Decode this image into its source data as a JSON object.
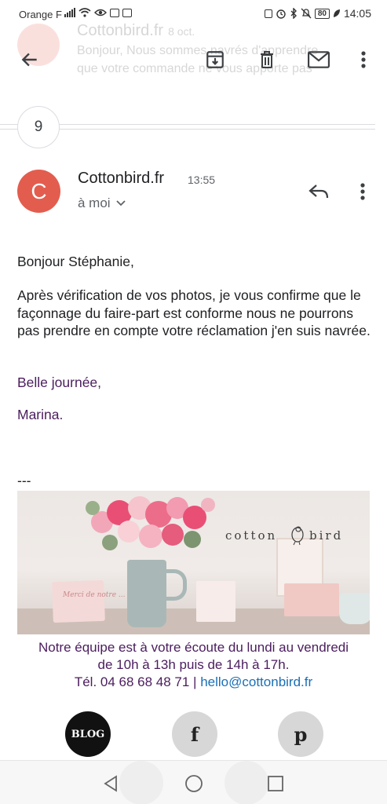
{
  "status_bar": {
    "carrier": "Orange F",
    "battery": "80",
    "time": "14:05"
  },
  "previous_message": {
    "sender": "Cottonbird.fr",
    "date": "8 oct.",
    "line1": "Bonjour, Nous sommes navrés d'apprendre",
    "line2": "que votre commande ne vous apporte pas"
  },
  "toolbar": {
    "back_icon": "arrow-back-icon",
    "archive_icon": "archive-icon",
    "delete_icon": "trash-icon",
    "mark_unread_icon": "mail-icon",
    "more_icon": "more-vert-icon"
  },
  "thread": {
    "collapsed_count": "9"
  },
  "message": {
    "avatar_letter": "C",
    "avatar_color": "#e35d4f",
    "sender": "Cottonbird.fr",
    "time": "13:55",
    "recipient": "à moi",
    "body": {
      "greeting": "Bonjour Stéphanie,",
      "paragraph": "Après vérification de vos photos, je vous confirme que le façonnage du faire-part est conforme nous ne pourrons pas prendre en compte votre réclamation j'en suis navrée.",
      "closing": "Belle journée,",
      "signature": "Marina.",
      "separator": "---"
    },
    "banner": {
      "logo_left": "cotton",
      "logo_right": "bird",
      "card_text": "Merci de notre ..."
    },
    "contact": {
      "line1": "Notre équipe est à votre écoute du lundi au vendredi",
      "line2": "de 10h à 13h puis de 14h à 17h.",
      "phone": "Tél. 04 68 68 48 71 |",
      "email": "hello@cottonbird.fr"
    },
    "social": {
      "blog": "BLOG",
      "facebook": "f",
      "pinterest": "p"
    }
  },
  "colors": {
    "accent_purple": "#4b1d5e",
    "link_blue": "#1a6fb7"
  }
}
